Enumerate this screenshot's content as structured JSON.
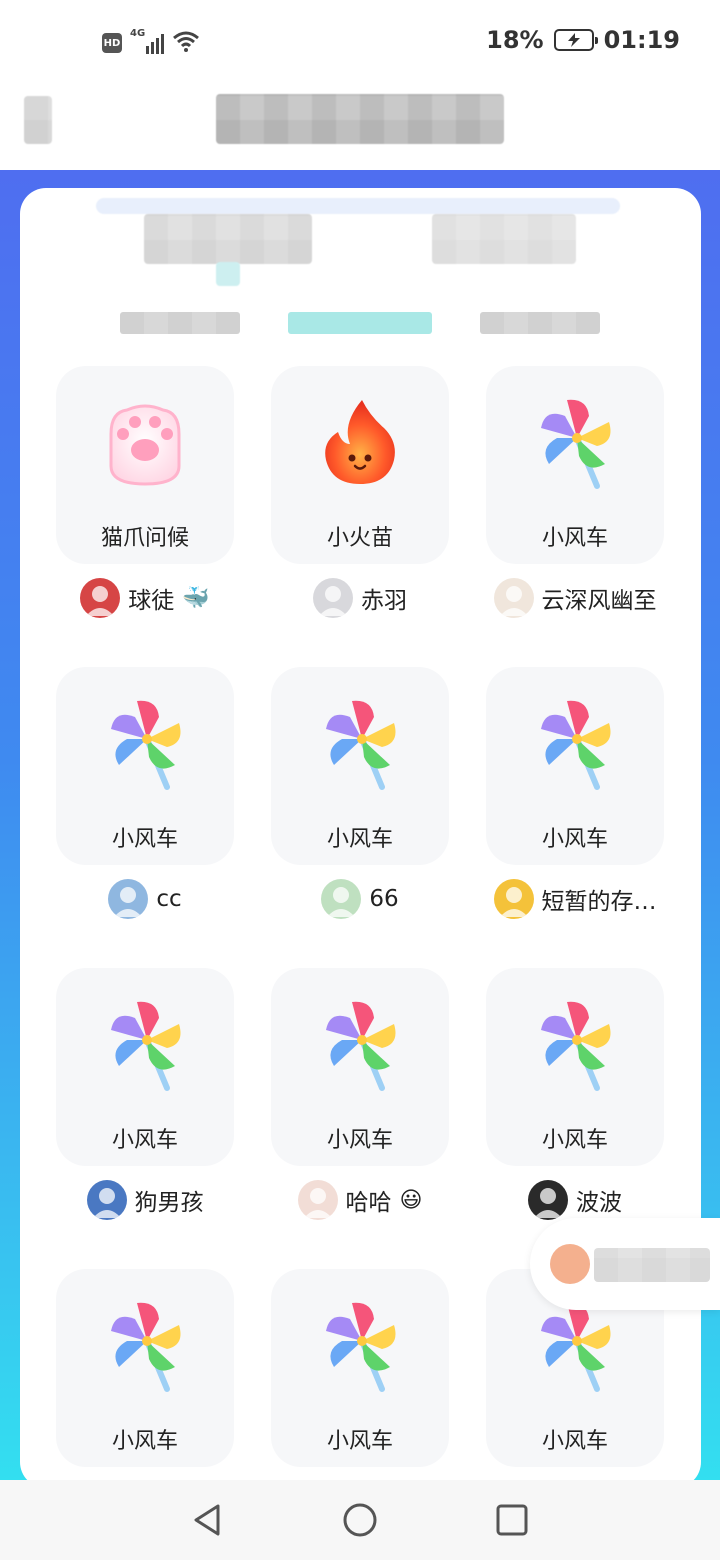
{
  "status_bar": {
    "network_type": "4G",
    "hd_label": "HD",
    "battery": "18%",
    "time": "01:19"
  },
  "gifts": [
    {
      "name": "猫爪问候",
      "icon": "cat-paw-icon",
      "sender": "球徒",
      "sender_emoji": "🐳",
      "avatar_color": "#d64545"
    },
    {
      "name": "小火苗",
      "icon": "flame-icon",
      "sender": "赤羽",
      "sender_emoji": "",
      "avatar_color": "#d8d8dc"
    },
    {
      "name": "小风车",
      "icon": "pinwheel-icon",
      "sender": "云深风幽至",
      "sender_emoji": "",
      "avatar_color": "#f0e6dc"
    },
    {
      "name": "小风车",
      "icon": "pinwheel-icon",
      "sender": "cc",
      "sender_emoji": "",
      "avatar_color": "#8fb7e0"
    },
    {
      "name": "小风车",
      "icon": "pinwheel-icon",
      "sender": "66",
      "sender_emoji": "",
      "avatar_color": "#bfe0c0"
    },
    {
      "name": "小风车",
      "icon": "pinwheel-icon",
      "sender": "短暂的存…",
      "sender_emoji": "",
      "avatar_color": "#f4c23a"
    },
    {
      "name": "小风车",
      "icon": "pinwheel-icon",
      "sender": "狗男孩",
      "sender_emoji": "",
      "avatar_color": "#4a78c2"
    },
    {
      "name": "小风车",
      "icon": "pinwheel-icon",
      "sender": "哈哈",
      "sender_emoji": "😃",
      "avatar_color": "#f2ddd6"
    },
    {
      "name": "小风车",
      "icon": "pinwheel-icon",
      "sender": "波波",
      "sender_emoji": "",
      "avatar_color": "#2a2a2a"
    },
    {
      "name": "小风车",
      "icon": "pinwheel-icon",
      "sender": "",
      "sender_emoji": "",
      "avatar_color": ""
    },
    {
      "name": "小风车",
      "icon": "pinwheel-icon",
      "sender": "",
      "sender_emoji": "",
      "avatar_color": ""
    },
    {
      "name": "小风车",
      "icon": "pinwheel-icon",
      "sender": "",
      "sender_emoji": "",
      "avatar_color": ""
    }
  ],
  "nav": {
    "back_icon": "triangle-back-icon",
    "home_icon": "circle-home-icon",
    "recents_icon": "square-recents-icon"
  }
}
